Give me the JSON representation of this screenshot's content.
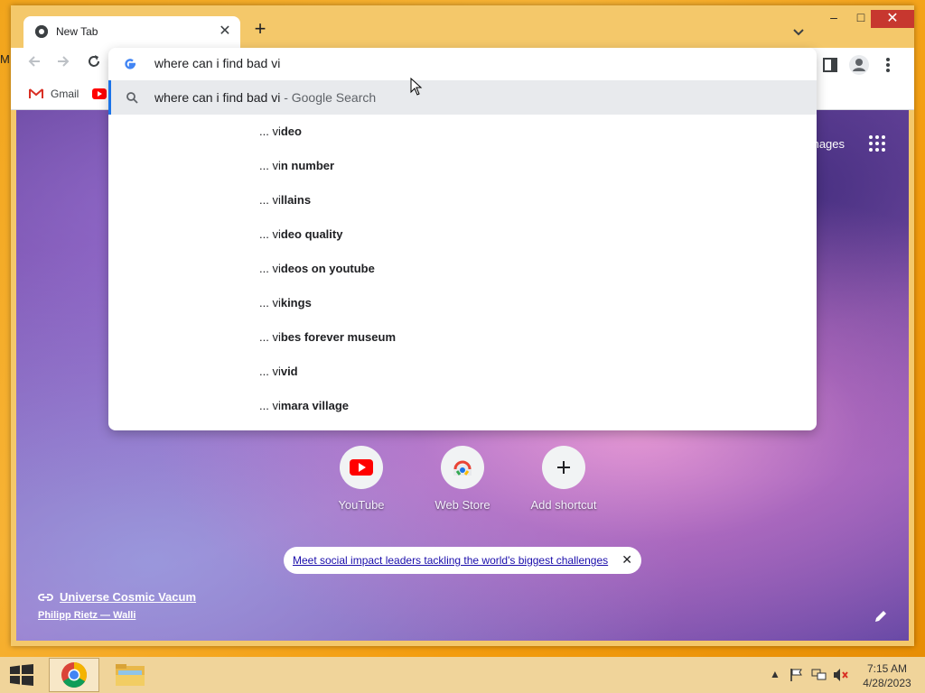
{
  "desktop": {
    "edge_letter": "M"
  },
  "browser": {
    "tab": {
      "title": "New Tab"
    },
    "window_controls": {
      "minimize": "–",
      "maximize": "□",
      "close": "✕"
    },
    "nav": {
      "back_icon": "arrow-left-icon",
      "forward_icon": "arrow-right-icon",
      "reload_icon": "reload-icon"
    },
    "bookmarks": [
      {
        "label": "Gmail"
      }
    ]
  },
  "omnibox": {
    "query": "where can i find bad vi",
    "first_suggestion": {
      "text": "where can i find bad vi",
      "suffix": " - Google Search"
    },
    "suggestions": [
      {
        "prefix": "... vi",
        "completion": "deo"
      },
      {
        "prefix": "... vi",
        "completion": "n number"
      },
      {
        "prefix": "... vi",
        "completion": "llains"
      },
      {
        "prefix": "... vi",
        "completion": "deo quality"
      },
      {
        "prefix": "... vi",
        "completion": "deos on youtube"
      },
      {
        "prefix": "... vi",
        "completion": "kings"
      },
      {
        "prefix": "... vi",
        "completion": "bes forever museum"
      },
      {
        "prefix": "... vi",
        "completion": "vid"
      },
      {
        "prefix": "... vi",
        "completion": "mara vi",
        "tail": "llage"
      }
    ]
  },
  "newtab": {
    "images_link": "mages",
    "shortcuts": [
      {
        "label": "YouTube",
        "icon": "youtube-icon"
      },
      {
        "label": "Web Store",
        "icon": "webstore-icon"
      },
      {
        "label": "Add shortcut",
        "icon": "plus-icon"
      }
    ],
    "promo": "Meet social impact leaders tackling the world's biggest challenges",
    "attribution": {
      "title": "Universe Cosmic Vacum",
      "author": "Philipp Rietz — Walli"
    }
  },
  "taskbar": {
    "clock_time": "7:15 AM",
    "clock_date": "4/28/2023"
  },
  "colors": {
    "accent": "#1a73e8",
    "close_red": "#c7372f",
    "desktop": "#f2a51c"
  }
}
